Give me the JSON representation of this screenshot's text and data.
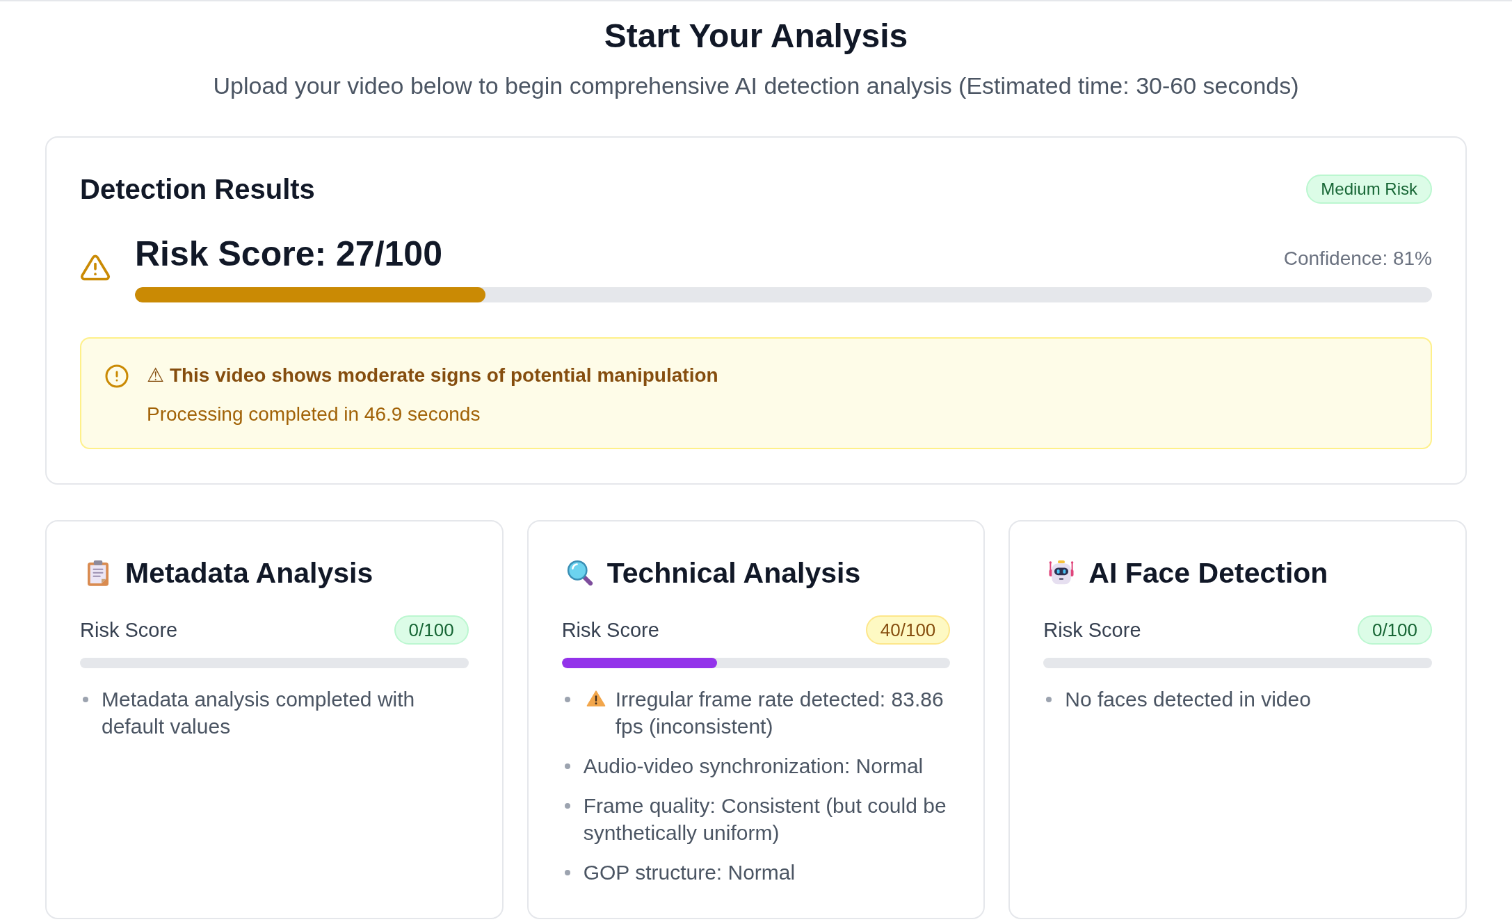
{
  "header": {
    "title": "Start Your Analysis",
    "subtitle": "Upload your video below to begin comprehensive AI detection analysis (Estimated time: 30-60 seconds)"
  },
  "detection_results": {
    "title": "Detection Results",
    "badge": {
      "label": "Medium Risk",
      "kind": "success"
    },
    "risk_score": "Risk Score: 27/100",
    "confidence": "Confidence: 81%",
    "bar": {
      "level": 0.27
    },
    "alert": {
      "message": "⚠ This video shows moderate signs of potential manipulation",
      "detail": "Processing completed in 46.9 seconds"
    }
  },
  "analyses": [
    {
      "title": "Metadata Analysis",
      "score_label": "Risk Score",
      "badge": {
        "label": "0/100",
        "kind": "success"
      },
      "bar": {
        "level": 0
      },
      "findings": [
        {
          "kind": "note",
          "text": "Metadata analysis completed with default values"
        }
      ]
    },
    {
      "title": "Technical Analysis",
      "score_label": "Risk Score",
      "badge": {
        "label": "40/100",
        "kind": "warning"
      },
      "bar": {
        "level": 0.4,
        "color": "#9333ea"
      },
      "findings": [
        {
          "kind": "warning",
          "text": "Irregular frame rate detected: 83.86 fps (inconsistent)"
        },
        {
          "kind": "note",
          "text": "Audio-video synchronization: Normal"
        },
        {
          "kind": "note",
          "text": "Frame quality: Consistent (but could be synthetically uniform)"
        },
        {
          "kind": "note",
          "text": "GOP structure: Normal"
        }
      ]
    },
    {
      "title": "AI Face Detection",
      "score_label": "Risk Score",
      "badge": {
        "label": "0/100",
        "kind": "success"
      },
      "bar": {
        "level": 0
      },
      "findings": [
        {
          "kind": "note",
          "text": "No faces detected in video"
        }
      ]
    }
  ]
}
